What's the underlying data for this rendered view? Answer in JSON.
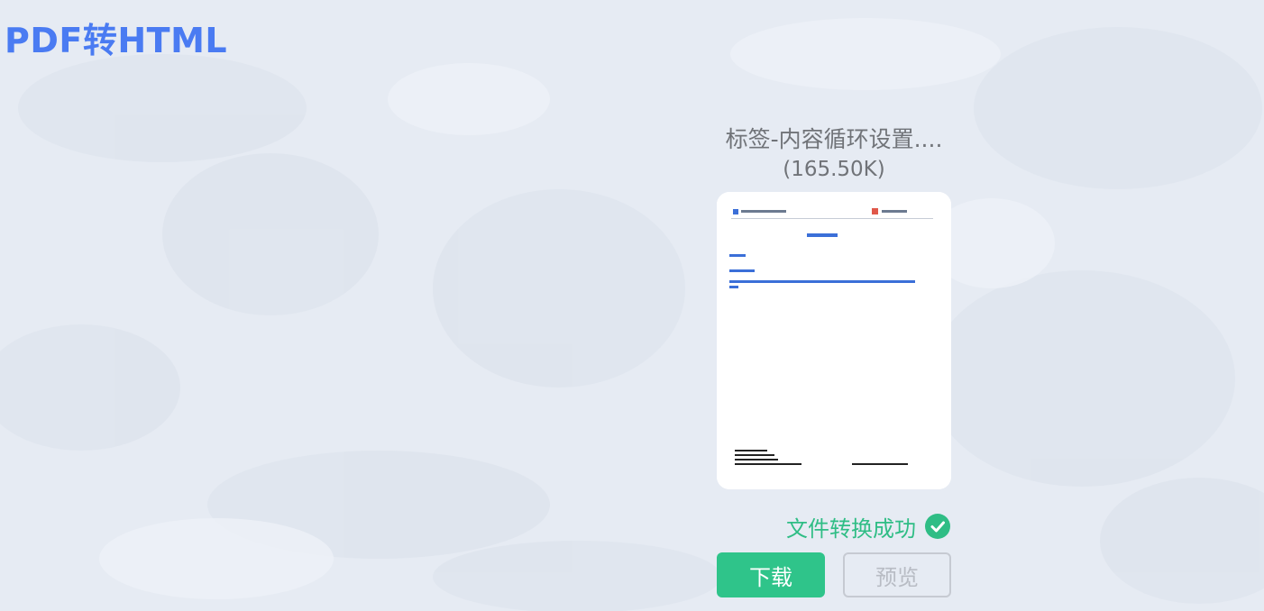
{
  "page": {
    "title": "PDF转HTML"
  },
  "file": {
    "name": "标签-内容循环设置....",
    "size": "(165.50K)"
  },
  "status": {
    "text": "文件转换成功",
    "icon": "check-circle-icon"
  },
  "actions": {
    "download_label": "下载",
    "preview_label": "预览"
  },
  "colors": {
    "title": "#4a7bf2",
    "text_gray": "#707378",
    "success": "#2fbd85",
    "download_bg": "#2fc48a",
    "preview_border": "#c6cad2",
    "preview_text": "#b8bcc4",
    "background": "#e6ebf3"
  }
}
